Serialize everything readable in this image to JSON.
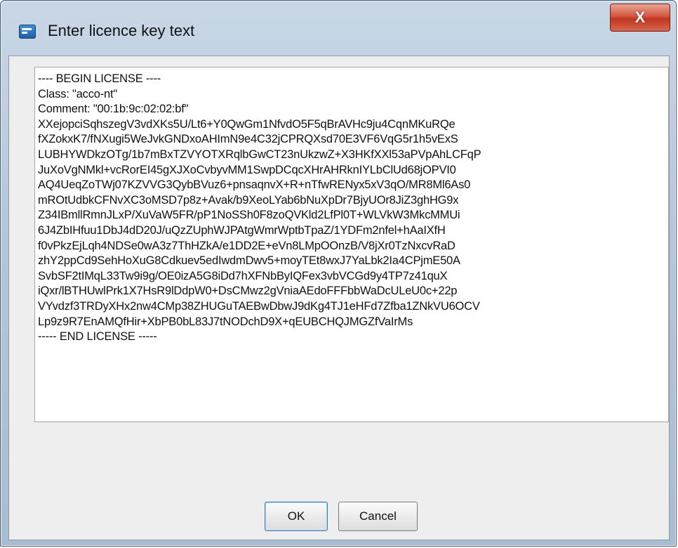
{
  "window": {
    "title": "Enter licence key text",
    "close_label": "X"
  },
  "license_text": [
    "---- BEGIN LICENSE ----",
    "Class: \"acco-nt\"",
    "Comment: \"00:1b:9c:02:02:bf\"",
    "XXejopciSqhszegV3vdXKs5U/Lt6+Y0QwGm1NfvdO5F5qBrAVHc9ju4CqnMKuRQe",
    "fXZokxK7/fNXugi5WeJvkGNDxoAHImN9e4C32jCPRQXsd70E3VF6VqG5r1h5vExS",
    "LUBHYWDkzOTg/1b7mBxTZVYOTXRqlbGwCT23nUkzwZ+X3HKfXXl53aPVpAhLCFqP",
    "JuXoVgNMkl+vcRorEI45gXJXoCvbyvMM1SwpDCqcXHrAHRknIYLbClUd68jOPVI0",
    "AQ4UeqZoTWj07KZVVG3QybBVuz6+pnsaqnvX+R+nTfwRENyx5xV3qO/MR8Ml6As0",
    "mROtUdbkCFNvXC3oMSD7p8z+Avak/b9XeoLYab6bNuXpDr7BjyUOr8JiZ3ghHG9x",
    "Z34IBmllRmnJLxP/XuVaW5FR/pP1NoSSh0F8zoQVKld2LfPl0T+WLVkW3MkcMMUi",
    "6J4ZbIHfuu1DbJ4dD20J/uQzZUphWJPAtgWmrWptbTpaZ/1YDFm2nfel+hAaIXfH",
    "f0vPkzEjLqh4NDSe0wA3z7ThHZkA/e1DD2E+eVn8LMpOOnzB/V8jXr0TzNxcvRaD",
    "zhY2ppCd9SehHoXuG8Cdkuev5edIwdmDwv5+moyTEt8wxJ7YaLbk2Ia4CPjmE50A",
    "SvbSF2tIMqL33Tw9i9g/OE0izA5G8iDd7hXFNbByIQFex3vbVCGd9y4TP7z41quX",
    "iQxr/lBTHUwlPrk1X7HsR9lDdpW0+DsCMwz2gVniaAEdoFFFbbWaDcULeU0c+22p",
    "VYvdzf3TRDyXHx2nw4CMp38ZHUGuTAEBwDbwJ9dKg4TJ1eHFd7Zfba1ZNkVU6OCV",
    "Lp9z9R7EnAMQfHir+XbPB0bL83J7tNODchD9X+qEUBCHQJMGZfVaIrMs",
    "----- END LICENSE -----"
  ],
  "buttons": {
    "ok": "OK",
    "cancel": "Cancel"
  }
}
